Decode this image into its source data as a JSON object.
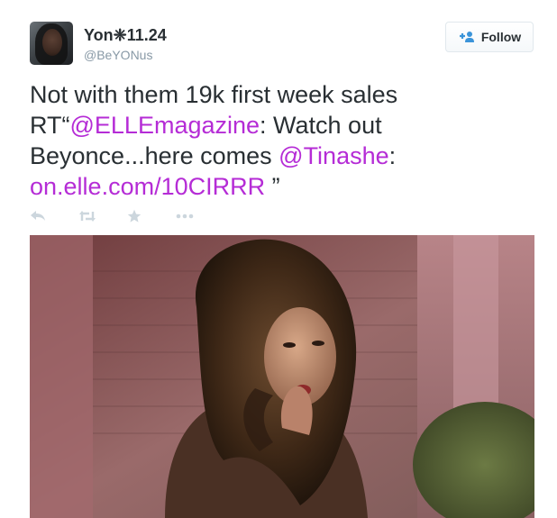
{
  "tweet": {
    "user": {
      "name": "Yon❈11.24",
      "screen_name": "@BeYONus"
    },
    "follow_button": {
      "label": "Follow",
      "icon": "follow-person-plus-icon"
    },
    "text": {
      "part1": "Not with them 19k first week sales RT“",
      "mention_elle": "@ELLEmagazine",
      "part2": ": Watch out Beyonce...here comes ",
      "mention_tinashe": "@Tinashe",
      "part3": ": ",
      "link": "on.elle.com/10CIRRR",
      "part4": " ”"
    },
    "actions": [
      {
        "name": "reply",
        "icon": "reply-icon"
      },
      {
        "name": "retweet",
        "icon": "retweet-icon"
      },
      {
        "name": "favorite",
        "icon": "star-icon"
      },
      {
        "name": "more",
        "icon": "more-icon"
      }
    ],
    "colors": {
      "link": "#b52cd6",
      "action_icon": "#ccd6dd",
      "screen_name": "#8899a6",
      "text": "#292f33"
    }
  }
}
